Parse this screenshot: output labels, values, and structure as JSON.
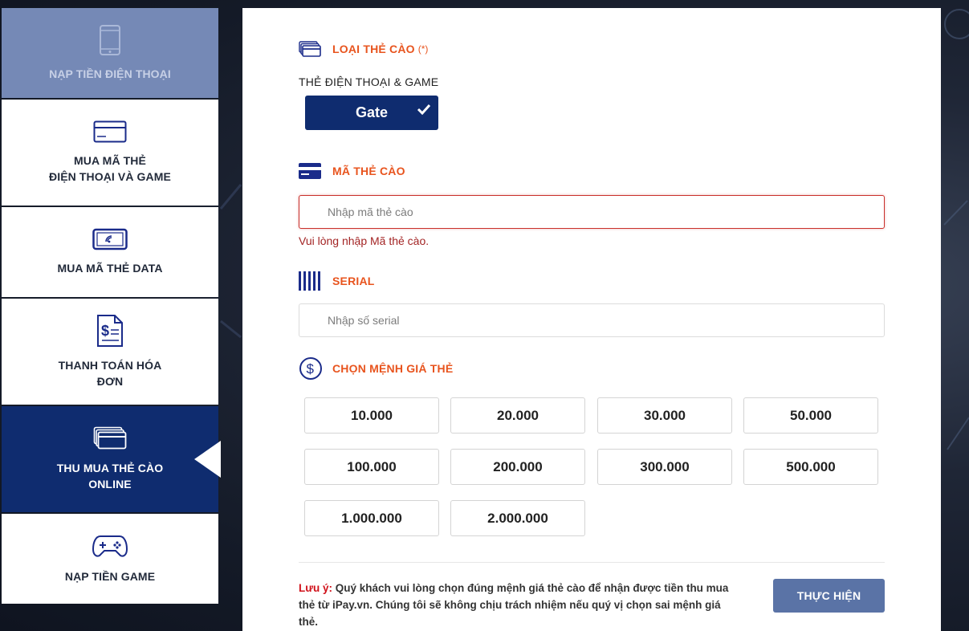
{
  "sidebar": {
    "items": [
      {
        "label": "NẠP TIỀN ĐIỆN THOẠI",
        "icon": "smartphone-icon",
        "state": "disabled"
      },
      {
        "label": "MUA MÃ THẺ\nĐIỆN THOẠI VÀ GAME",
        "icon": "card-icon",
        "state": "normal"
      },
      {
        "label": "MUA MÃ THẺ DATA",
        "icon": "data-phone-icon",
        "state": "normal"
      },
      {
        "label": "THANH TOÁN HÓA\nĐƠN",
        "icon": "bill-icon",
        "state": "normal"
      },
      {
        "label": "THU MUA THẺ CÀO\nONLINE",
        "icon": "cards-stack-icon",
        "state": "active"
      },
      {
        "label": "NẠP TIỀN GAME",
        "icon": "gamepad-icon",
        "state": "normal"
      }
    ]
  },
  "card_type": {
    "title": "LOẠI THẺ CÀO",
    "required_mark": "(*)",
    "subtitle": "THẺ ĐIỆN THOẠI & GAME",
    "selected": "Gate"
  },
  "card_code": {
    "title": "MÃ THẺ CÀO",
    "placeholder": "Nhập mã thẻ cào",
    "value": "",
    "error": "Vui lòng nhập Mã thẻ cào."
  },
  "serial": {
    "title": "SERIAL",
    "placeholder": "Nhập số serial",
    "value": ""
  },
  "denomination": {
    "title": "CHỌN MỆNH GIÁ THẺ",
    "options": [
      "10.000",
      "20.000",
      "30.000",
      "50.000",
      "100.000",
      "200.000",
      "300.000",
      "500.000",
      "1.000.000",
      "2.000.000"
    ]
  },
  "note": {
    "label": "Lưu ý:",
    "text": " Quý khách vui lòng chọn đúng mệnh giá thẻ cào để nhận được tiền thu mua thẻ từ iPay.vn. Chúng tôi sẽ không chịu trách nhiệm nếu quý vị chọn sai mệnh giá thẻ."
  },
  "submit_label": "THỰC HIỆN",
  "colors": {
    "primary": "#0f2c6f",
    "accent": "#e8541e",
    "error": "#a32424",
    "submit": "#5a73a6"
  }
}
